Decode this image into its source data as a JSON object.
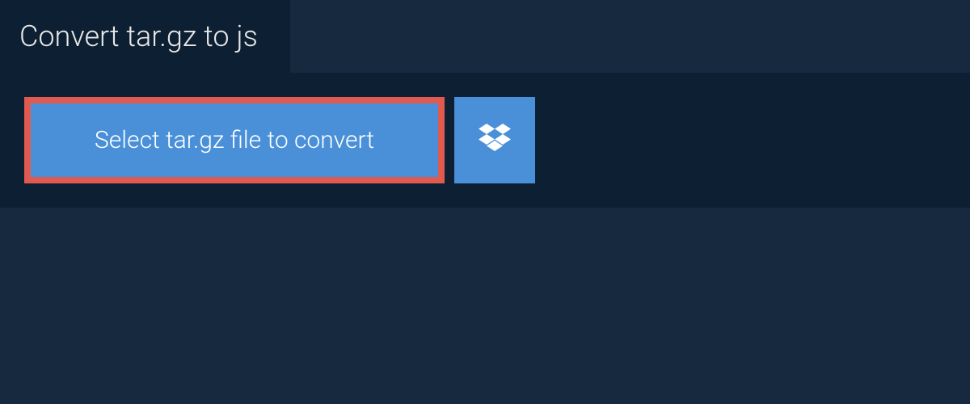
{
  "header": {
    "title": "Convert tar.gz to js"
  },
  "upload": {
    "select_button_label": "Select tar.gz file to convert"
  },
  "icons": {
    "dropbox": "dropbox-icon"
  },
  "colors": {
    "background": "#16293f",
    "panel": "#0d1f33",
    "button_primary": "#4a90d9",
    "button_border": "#e05a50",
    "text_light": "#e8e8e8",
    "text_white": "#ffffff"
  }
}
